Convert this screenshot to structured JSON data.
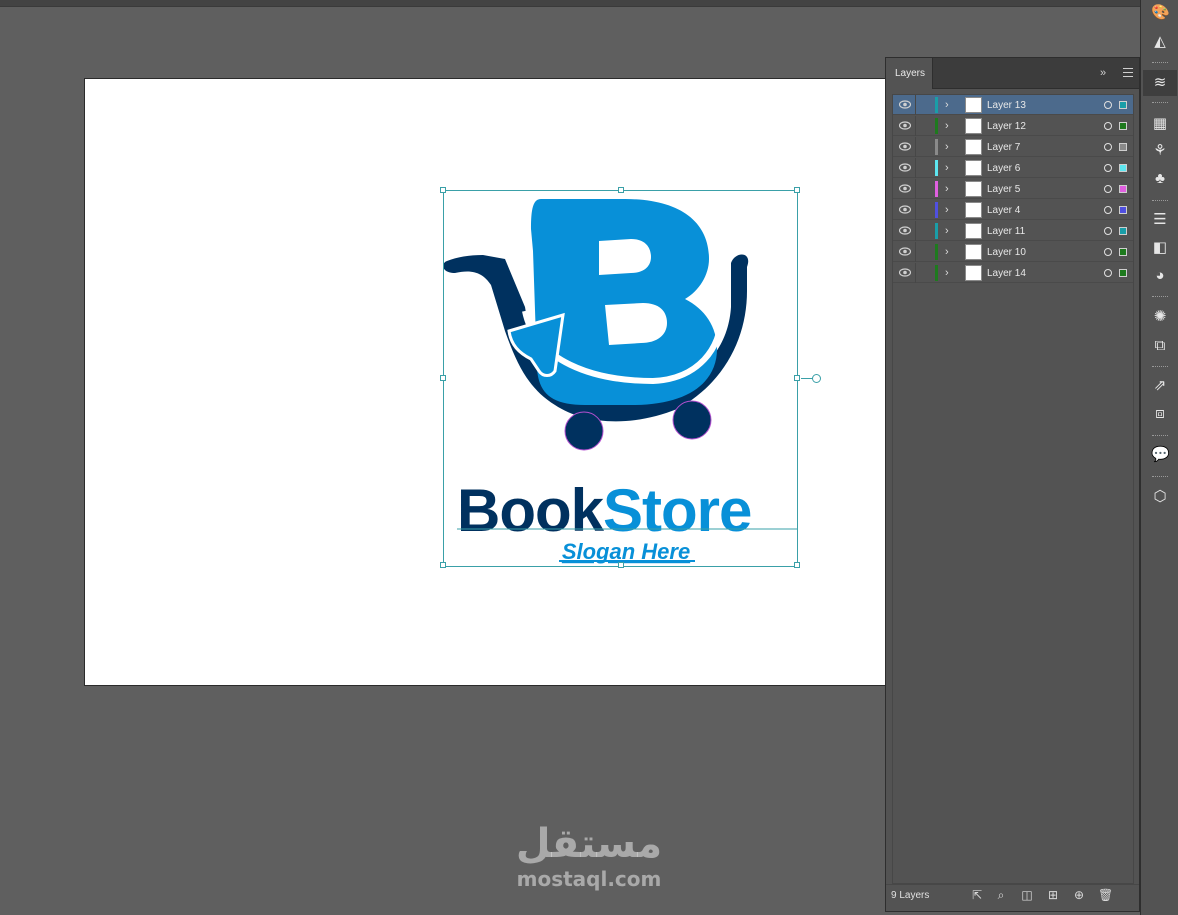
{
  "artboard": {
    "brand_part1": "Book",
    "brand_part2": "Store",
    "slogan": "Slogan Here"
  },
  "colors": {
    "dark_blue": "#00315f",
    "light_blue": "#0890d8",
    "selection": "#3aa0a8"
  },
  "layers_panel": {
    "tab_label": "Layers",
    "layer_count": "9 Layers",
    "layers": [
      {
        "name": "Layer 13",
        "color": "#1a9ea8",
        "selected": true
      },
      {
        "name": "Layer 12",
        "color": "#1e7a1e",
        "selected": false
      },
      {
        "name": "Layer 7",
        "color": "#8a8a8a",
        "selected": false
      },
      {
        "name": "Layer 6",
        "color": "#5ee6f0",
        "selected": false
      },
      {
        "name": "Layer 5",
        "color": "#e060e0",
        "selected": false
      },
      {
        "name": "Layer 4",
        "color": "#5050e0",
        "selected": false
      },
      {
        "name": "Layer 11",
        "color": "#1a9ea8",
        "selected": false
      },
      {
        "name": "Layer 10",
        "color": "#1e7a1e",
        "selected": false
      },
      {
        "name": "Layer 14",
        "color": "#1e7a1e",
        "selected": false
      }
    ]
  },
  "watermark": {
    "arabic": "مستقل",
    "latin": "mostaql.com"
  }
}
